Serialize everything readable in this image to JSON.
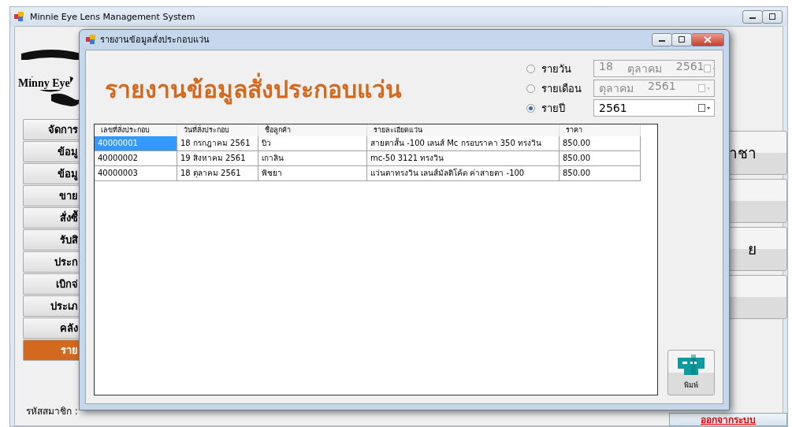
{
  "main_window": {
    "title": "Minnie Eye Lens Management System",
    "logo_text": "Minny Eye",
    "menu": [
      {
        "label": "จัดการ",
        "selected": false
      },
      {
        "label": "ข้อมู",
        "selected": false
      },
      {
        "label": "ข้อมู",
        "selected": false
      },
      {
        "label": "ขาย",
        "selected": false
      },
      {
        "label": "สั่งซื้",
        "selected": false
      },
      {
        "label": "รับสิ",
        "selected": false
      },
      {
        "label": "ประก",
        "selected": false
      },
      {
        "label": "เบิกจ่",
        "selected": false
      },
      {
        "label": "ประเภ",
        "selected": false
      },
      {
        "label": "คลัง",
        "selected": false
      },
      {
        "label": "ราย",
        "selected": true
      }
    ],
    "right_buttons": [
      {
        "kind": "text",
        "label": "าชา"
      },
      {
        "kind": "blank"
      },
      {
        "kind": "text",
        "label": "ย"
      },
      {
        "kind": "blank"
      }
    ],
    "member_label": "รหัสสมาชิก :",
    "logout": "ออกจากระบบ"
  },
  "dialog": {
    "title": "รายงานข้อมูลสั่งประกอบแว่น",
    "heading": "รายงานข้อมูลสั่งประกอบแว่น",
    "filters": [
      {
        "label": "รายวัน",
        "selected": false,
        "disabled": true,
        "parts": [
          "18",
          "ตุลาคม",
          "2561"
        ]
      },
      {
        "label": "รายเดือน",
        "selected": false,
        "disabled": true,
        "parts": [
          "ตุลาคม",
          "2561"
        ]
      },
      {
        "label": "รายปี",
        "selected": true,
        "disabled": false,
        "parts": [
          "2561"
        ]
      }
    ],
    "table": {
      "columns": [
        "เลขที่สั่งประกอบ",
        "วันที่สั่งประกอบ",
        "ชื่อลูกค้า",
        "รายละเอียดแว่น",
        "ราคา"
      ],
      "rows": [
        {
          "selected": true,
          "cells": [
            "40000001",
            "18 กรกฎาคม 2561",
            "บิว",
            "สายตาสั้น -100 เลนส์ Mc  กรอบราคา 350 ทรงวิน",
            "850.00"
          ]
        },
        {
          "selected": false,
          "cells": [
            "40000002",
            "19 สิงหาคม 2561",
            "เกาลิน",
            "mc-50 3121 ทรงวิน",
            "850.00"
          ]
        },
        {
          "selected": false,
          "cells": [
            "40000003",
            "18 ตุลาคม 2561",
            "พิชยา",
            "แว่นตาทรงวิน เลนส์มัลติโค้ด ค่าสายตา -100",
            "850.00"
          ]
        }
      ]
    },
    "print_button": "พิมพ์"
  }
}
